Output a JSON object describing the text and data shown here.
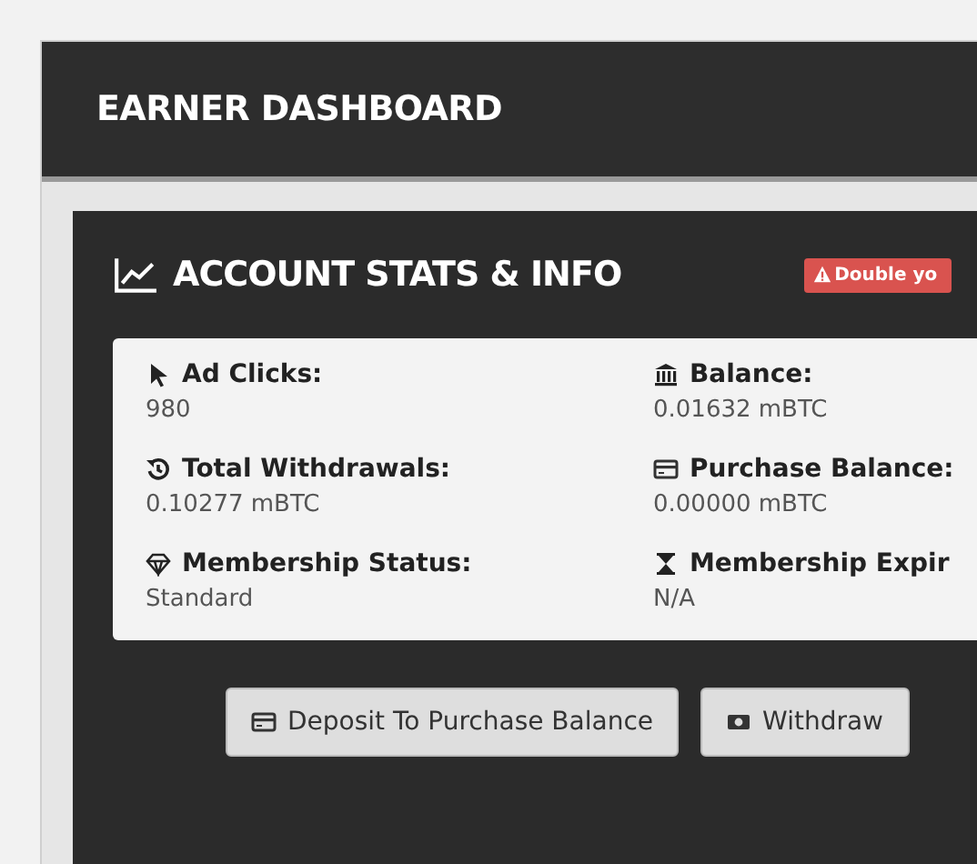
{
  "dashboard": {
    "title": "EARNER DASHBOARD"
  },
  "section": {
    "title": "ACCOUNT STATS & INFO",
    "alert": "Double yo"
  },
  "stats": [
    {
      "kind": "pointer",
      "label": "Ad Clicks:",
      "value": "980"
    },
    {
      "kind": "bank",
      "label": "Balance:",
      "value": "0.01632 mBTC"
    },
    {
      "kind": "history",
      "label": "Total Withdrawals:",
      "value": "0.10277 mBTC"
    },
    {
      "kind": "card",
      "label": "Purchase Balance:",
      "value": "0.00000 mBTC"
    },
    {
      "kind": "diamond",
      "label": "Membership Status:",
      "value": "Standard"
    },
    {
      "kind": "hourglass",
      "label": "Membership Expir",
      "value": "N/A"
    }
  ],
  "buttons": [
    {
      "kind": "card",
      "label": "Deposit To Purchase Balance"
    },
    {
      "kind": "money",
      "label": "Withdraw"
    }
  ]
}
